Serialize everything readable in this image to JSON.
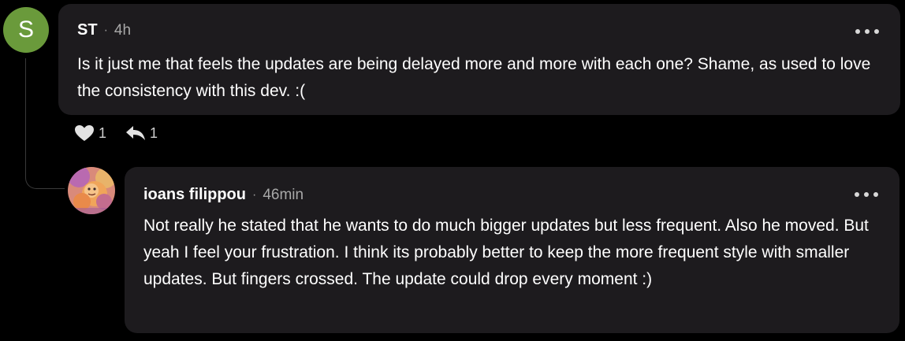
{
  "colors": {
    "background": "#000000",
    "bubble": "#1d1b1e",
    "avatar_st": "#6a9a3b",
    "secondary_text": "#a8a8a8"
  },
  "comments": [
    {
      "avatar_letter": "S",
      "author": "ST",
      "separator": "·",
      "time": "4h",
      "text": "Is it just me that feels the updates are being delayed more and more with each one? Shame, as used to love the consistency with this dev. :(",
      "like_icon": "heart-icon",
      "like_count": "1",
      "reply_icon": "reply-icon",
      "reply_count": "1",
      "more_icon": "more-horizontal-icon"
    },
    {
      "avatar_icon": "user-avatar-image",
      "author": "ioans filippou",
      "separator": "·",
      "time": "46min",
      "text": "Not really he stated that he wants to do much bigger updates but less frequent. Also he moved. But yeah I feel your frustration. I think its probably better to keep the more frequent style with smaller updates. But fingers crossed. The update could drop every moment :)",
      "more_icon": "more-horizontal-icon"
    }
  ]
}
